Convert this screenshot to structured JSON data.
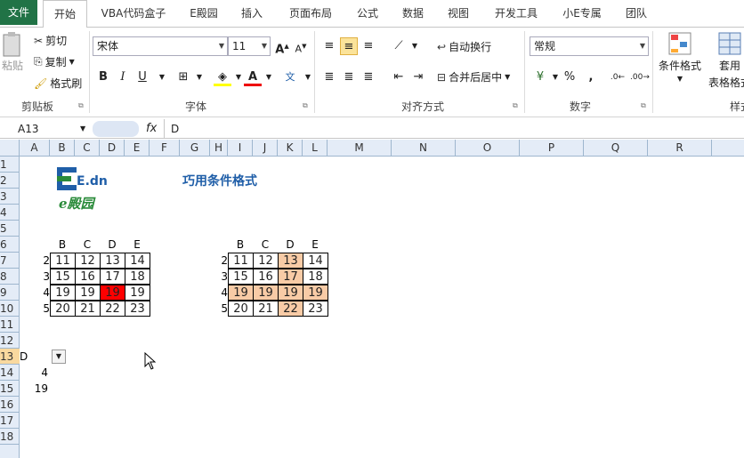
{
  "tabs": [
    "文件",
    "开始",
    "VBA代码盒子",
    "E殿园",
    "插入",
    "页面布局",
    "公式",
    "数据",
    "视图",
    "开发工具",
    "小E专属",
    "团队"
  ],
  "ribbon": {
    "clipboard": {
      "paste": "粘贴",
      "cut": "剪切",
      "copy": "复制",
      "format_painter": "格式刷",
      "label": "剪贴板"
    },
    "font": {
      "name": "宋体",
      "size": "11",
      "label": "字体",
      "bold": "B",
      "italic": "I",
      "underline": "U",
      "grow": "A",
      "shrink": "A"
    },
    "align": {
      "wrap": "自动换行",
      "merge": "合并后居中",
      "label": "对齐方式"
    },
    "number": {
      "format": "常规",
      "percent": "%",
      "comma": ",",
      "label": "数字"
    },
    "styles": {
      "cond_format": "条件格式",
      "table_format_1": "套用",
      "table_format_2": "表格格式",
      "label": "样式"
    }
  },
  "formula_bar": {
    "name_box": "A13",
    "fx": "fx",
    "content": "D"
  },
  "columns": [
    "A",
    "B",
    "C",
    "D",
    "E",
    "F",
    "G",
    "H",
    "I",
    "J",
    "K",
    "L",
    "M",
    "N",
    "O",
    "P",
    "Q",
    "R"
  ],
  "rows": [
    "1",
    "2",
    "3",
    "4",
    "5",
    "6",
    "7",
    "8",
    "9",
    "10",
    "11",
    "12",
    "13",
    "14",
    "15",
    "16",
    "17",
    "18"
  ],
  "sheet": {
    "title": "巧用条件格式",
    "logo_text": "E.dn",
    "logo_sub": "e殿园",
    "table_headers": [
      "B",
      "C",
      "D",
      "E"
    ],
    "row_labels": [
      "2",
      "3",
      "4",
      "5"
    ],
    "left_table": [
      [
        "11",
        "12",
        "13",
        "14"
      ],
      [
        "15",
        "16",
        "17",
        "18"
      ],
      [
        "19",
        "19",
        "19",
        "19"
      ],
      [
        "20",
        "21",
        "22",
        "23"
      ]
    ],
    "right_table": [
      [
        "11",
        "12",
        "13",
        "14"
      ],
      [
        "15",
        "16",
        "17",
        "18"
      ],
      [
        "19",
        "19",
        "19",
        "19"
      ],
      [
        "20",
        "21",
        "22",
        "23"
      ]
    ],
    "left_highlight": "#ff0000",
    "right_highlight": "#f8cba6",
    "filter_header": "D",
    "filter_values": [
      "4",
      "19"
    ]
  }
}
